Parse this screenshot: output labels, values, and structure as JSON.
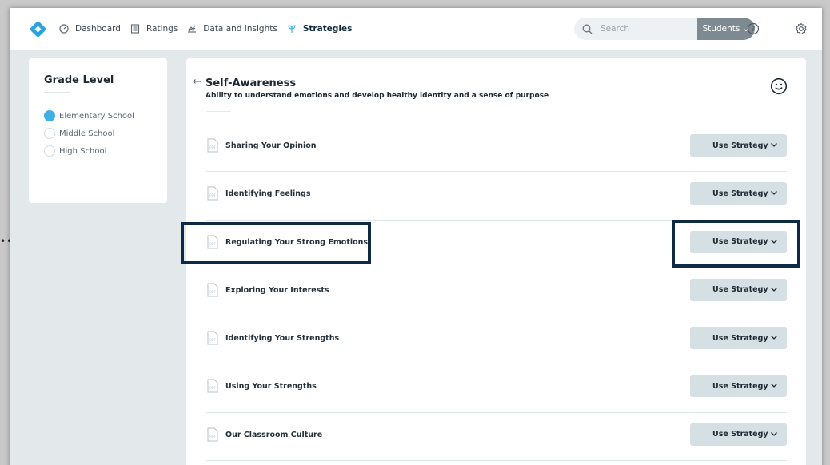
{
  "nav": {
    "items": [
      {
        "label": "Dashboard",
        "icon": "dashboard-icon"
      },
      {
        "label": "Ratings",
        "icon": "ratings-icon"
      },
      {
        "label": "Data and Insights",
        "icon": "data-insights-icon"
      },
      {
        "label": "Strategies",
        "icon": "strategies-icon",
        "active": true
      }
    ],
    "search_placeholder": "Search",
    "students_label": "Students ⌄"
  },
  "grade_panel": {
    "title": "Grade Level",
    "options": [
      {
        "label": "Elementary School",
        "checked": true
      },
      {
        "label": "Middle School",
        "checked": false
      },
      {
        "label": "High School",
        "checked": false
      }
    ]
  },
  "main": {
    "title": "Self-Awareness",
    "subtitle": "Ability to understand emotions and develop healthy identity and a sense of purpose",
    "back_icon": "←",
    "strategies": [
      {
        "label": "Sharing Your Opinion",
        "button": "Use Strategy"
      },
      {
        "label": "Identifying Feelings",
        "button": "Use Strategy"
      },
      {
        "label": "Regulating Your Strong Emotions",
        "button": "Use Strategy",
        "highlighted": true
      },
      {
        "label": "Exploring Your Interests",
        "button": "Use Strategy"
      },
      {
        "label": "Identifying Your Strengths",
        "button": "Use Strategy"
      },
      {
        "label": "Using Your Strengths",
        "button": "Use Strategy"
      },
      {
        "label": "Our Classroom Culture",
        "button": "Use Strategy"
      }
    ]
  },
  "colors": {
    "accent": "#3fb0e6",
    "highlight_border": "#0f2a47",
    "button_bg": "#d5e0e4",
    "students_bg": "#7d8a92"
  }
}
